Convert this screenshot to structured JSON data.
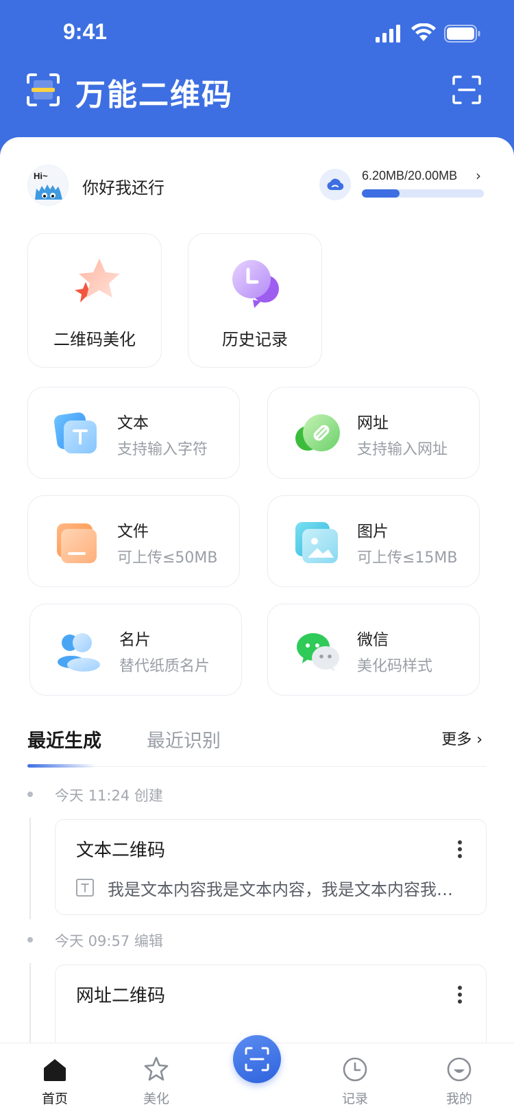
{
  "status_bar": {
    "time": "9:41"
  },
  "header": {
    "title": "万能二维码"
  },
  "user": {
    "name": "你好我还行",
    "avatar_text": "Hi~",
    "storage_text": "6.20MB/20.00MB",
    "storage_used_fraction": 0.31
  },
  "features": [
    {
      "label": "二维码美化",
      "icon": "star-icon"
    },
    {
      "label": "历史记录",
      "icon": "chat-bubble-icon"
    }
  ],
  "types": [
    {
      "title": "文本",
      "subtitle": "支持输入字符",
      "icon": "text-icon"
    },
    {
      "title": "网址",
      "subtitle": "支持输入网址",
      "icon": "link-icon"
    },
    {
      "title": "文件",
      "subtitle": "可上传≤50MB",
      "icon": "folder-icon"
    },
    {
      "title": "图片",
      "subtitle": "可上传≤15MB",
      "icon": "image-icon"
    },
    {
      "title": "名片",
      "subtitle": "替代纸质名片",
      "icon": "contact-icon"
    },
    {
      "title": "微信",
      "subtitle": "美化码样式",
      "icon": "wechat-icon"
    }
  ],
  "tabs": {
    "active": "最近生成",
    "inactive": "最近识别",
    "more": "更多 ›"
  },
  "records": [
    {
      "date": "今天 11:24 创建",
      "title": "文本二维码",
      "preview": "我是文本内容我是文本内容，我是文本内容我是文本内容"
    },
    {
      "date": "今天 09:57 编辑",
      "title": "网址二维码",
      "preview": ""
    }
  ],
  "nav": {
    "home": "首页",
    "beautify": "美化",
    "records": "记录",
    "mine": "我的"
  },
  "colors": {
    "brand": "#3d6fe2",
    "active_nav": "#1a1a1a",
    "inactive_nav": "#8a8e96"
  }
}
